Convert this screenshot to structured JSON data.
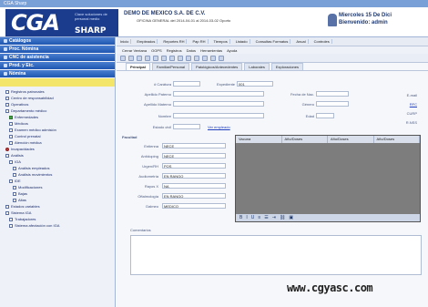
{
  "window": {
    "title": "CGA Sharp"
  },
  "header": {
    "logo_main": "CGA",
    "logo_sub": "SHARP",
    "logo_tagline": "Clave soluciones de personal medio",
    "company": "DEMO DE MEXICO S.A. DE C.V.",
    "company_sub": "OFICINA GENERAL del 2014-04-01 al 2014-03-02 Oporto",
    "date": "Miercoles 15 De Dici",
    "user": "Bienvenido: admin"
  },
  "sidebar": {
    "sections": [
      "Catálogos",
      "Proc. Nómina",
      "CNC de asistencia",
      "Prod. y Etc.",
      "Nómina"
    ],
    "tree": [
      {
        "label": "Registros patronales",
        "icon": "folder-icon"
      },
      {
        "label": "Centro de responsabilidad",
        "icon": "folder-icon"
      },
      {
        "label": "Operativos",
        "icon": "folder-icon"
      },
      {
        "label": "Departamento médico",
        "icon": "folder-icon"
      },
      {
        "label": "Enfermedades",
        "icon": "green-icon"
      },
      {
        "label": "Médicos",
        "icon": "folder-icon"
      },
      {
        "label": "Examen médico admisión",
        "icon": "folder-icon"
      },
      {
        "label": "Control prenatal",
        "icon": "folder-icon"
      },
      {
        "label": "Atención médica",
        "icon": "folder-icon"
      },
      {
        "label": "Incapacidades",
        "icon": "red-icon"
      },
      {
        "label": "Análisis",
        "icon": "folder-icon"
      },
      {
        "label": "IGA",
        "icon": "folder-icon"
      },
      {
        "label": "Análisis empleados",
        "icon": "folder-icon"
      },
      {
        "label": "Análisis movimientos",
        "icon": "folder-icon"
      },
      {
        "label": "IDE",
        "icon": "folder-icon"
      },
      {
        "label": "Modificaciones",
        "icon": "folder-icon"
      },
      {
        "label": "Bajas",
        "icon": "folder-icon"
      },
      {
        "label": "Altas",
        "icon": "folder-icon"
      },
      {
        "label": "Estados variables",
        "icon": "folder-icon"
      },
      {
        "label": "Sistema IGA",
        "icon": "folder-icon"
      },
      {
        "label": "Trabajadores",
        "icon": "folder-icon"
      },
      {
        "label": "Sistema afectación con IGA",
        "icon": "folder-icon"
      }
    ]
  },
  "main": {
    "tabs": [
      "Inicio",
      "Empleados",
      "Reportes RH",
      "Pap RH",
      "Tiempos",
      "Listado",
      "Consultas Formatos",
      "Anual",
      "Controles"
    ],
    "menu": [
      "Cerrar Ventana",
      "OOPS",
      "Registros",
      "Datos",
      "Herramientas",
      "Ayuda"
    ],
    "form_tabs": [
      "Principal",
      "Familiar/Personal",
      "Patológicos/Antecedentes",
      "Laborales",
      "Exploraciones"
    ],
    "fields": {
      "caratura_label": "# Carátura",
      "expediente_label": "Expediente",
      "expediente_value": "001",
      "apellido_paterno_label": "Apellido Paterno",
      "apellido_materno_label": "Apellido Materno",
      "nombre_label": "Nombre",
      "fecha_nac_label": "Fecha de Nac.",
      "genero_label": "Género",
      "edad_label": "Edad",
      "estado_civil_label": "Estado civil",
      "ver_empleado_link": "Ver empleado",
      "email_label": "E-mail",
      "rfc_label": "RFC",
      "curp_label": "CURP",
      "nss_label": "R.NSS"
    },
    "facultad": {
      "title": "Facultad",
      "rows": [
        {
          "label": "Entienna",
          "value": "NECE"
        },
        {
          "label": "Antídoping",
          "value": "NECE"
        },
        {
          "label": "Urgen/RH",
          "value": "POS"
        },
        {
          "label": "Audiometría",
          "value": "EN RANGO"
        },
        {
          "label": "Rayos X",
          "value": "NA"
        },
        {
          "label": "Oftalmología",
          "value": "EN RANGO"
        },
        {
          "label": "Dalmeo",
          "value": "MEDICO"
        }
      ]
    },
    "grid": {
      "headers": [
        "Vacuna",
        "Año/Doses",
        "Año/Doses",
        "Año/Doses"
      ]
    },
    "comments_label": "Comentarios",
    "watermark": "www.cgyasc.com"
  }
}
